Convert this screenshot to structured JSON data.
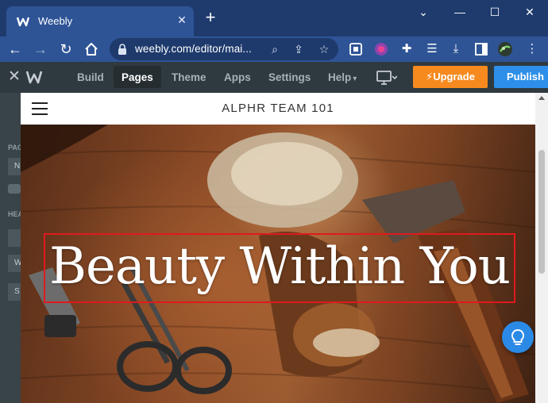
{
  "browser": {
    "tab_title": "Weebly",
    "url": "weebly.com/editor/mai...",
    "window_controls": {
      "minimize": "—",
      "maximize": "☐",
      "close": "✕"
    },
    "icons": [
      "back-icon",
      "forward-icon",
      "reload-icon",
      "home-icon",
      "lock-icon",
      "zoom-icon",
      "share-icon",
      "star-icon",
      "extension-icons",
      "profile-avatar"
    ]
  },
  "editor": {
    "menu": [
      "Build",
      "Pages",
      "Theme",
      "Apps",
      "Settings",
      "Help"
    ],
    "active_menu": "Pages",
    "help_caret": "▾",
    "upgrade_label": "Upgrade",
    "publish_label": "Publish",
    "sidebar": {
      "label_1": "PAG",
      "box_1": "N",
      "label_2": "HEA",
      "box_2": "W",
      "box_3": "S"
    }
  },
  "site": {
    "title": "ALPHR TEAM 101",
    "hero_title": "Beauty Within You"
  },
  "colors": {
    "tabbar": "#1f3b6e",
    "addressbar": "#2e5496",
    "editor_bar": "#2f3a40",
    "upgrade": "#f68a1f",
    "publish": "#2d8fe9",
    "highlight": "#e0191e"
  }
}
